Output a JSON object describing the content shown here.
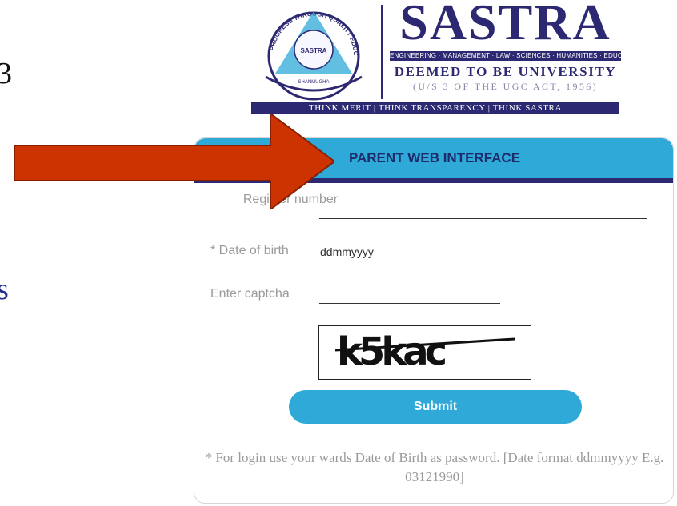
{
  "side_glyphs": {
    "top": "3",
    "middle": "s"
  },
  "logo": {
    "seal_ring_text": "PROGRESS THROUGH QUALITY EDUCATION",
    "seal_center": "SASTRA",
    "seal_lower": "SHANMUGHA",
    "brand_name": "SASTRA",
    "brand_subtitle": "ENGINEERING · MANAGEMENT · LAW · SCIENCES · HUMANITIES · EDUCATION",
    "deemed_line": "DEEMED TO BE UNIVERSITY",
    "ugc_line": "(U/S 3 OF THE UGC ACT, 1956)",
    "tagline": "THINK MERIT | THINK TRANSPARENCY | THINK SASTRA"
  },
  "card": {
    "title": "PARENT WEB INTERFACE",
    "register_label": "Register number",
    "dob_label": "* Date of birth",
    "dob_value": "ddmmyyyy",
    "captcha_label": "Enter captcha",
    "captcha_text": "k5kac",
    "submit_label": "Submit",
    "note": "* For login use your wards Date of Birth as password. [Date format ddmmyyyy E.g. 03121990]"
  },
  "colors": {
    "header": "#2ea9d8",
    "brand": "#2d2872",
    "arrow": "#cc3300"
  }
}
